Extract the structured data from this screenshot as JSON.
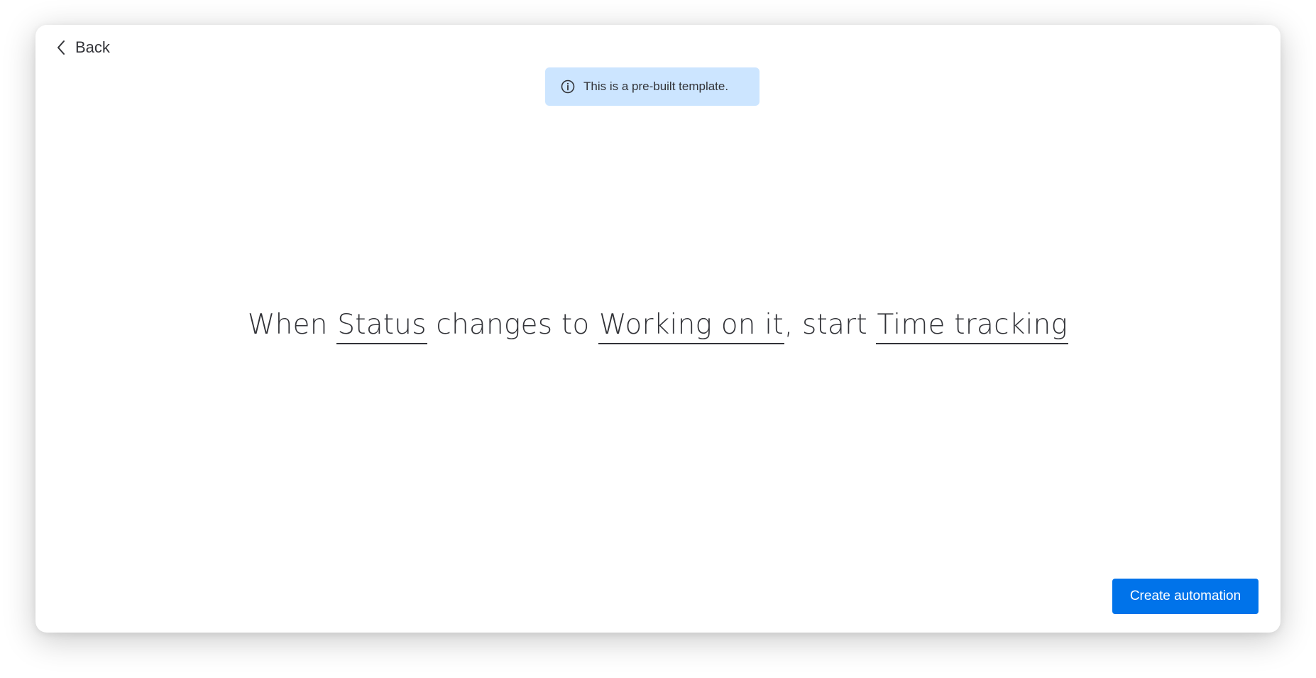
{
  "header": {
    "back_label": "Back",
    "back_icon": "chevron-left-icon"
  },
  "banner": {
    "icon": "info-icon",
    "text": "This is a pre-built template.",
    "background": "#cce5ff"
  },
  "recipe": {
    "part1": "When ",
    "trigger_column": "Status",
    "part2": " changes to ",
    "trigger_value": "Working on it",
    "part3": ", start ",
    "action_column": "Time tracking"
  },
  "footer": {
    "create_label": "Create automation",
    "create_color": "#0073ea"
  }
}
